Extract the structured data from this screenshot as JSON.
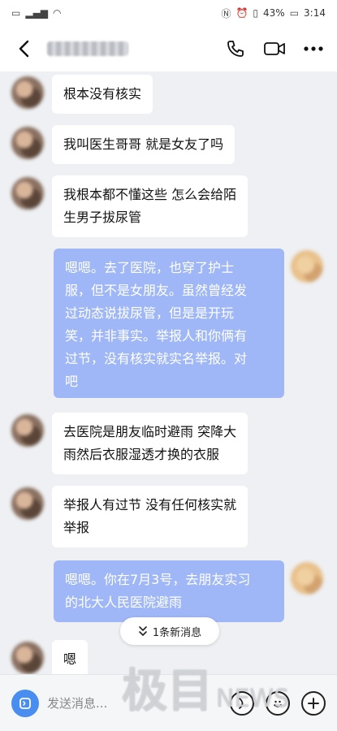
{
  "status_bar": {
    "battery": "43%",
    "time": "3:14"
  },
  "header": {
    "back_icon": "chevron-left-icon",
    "call_icon": "phone-icon",
    "video_icon": "video-camera-icon",
    "more_icon": "more-horizontal-icon"
  },
  "messages": [
    {
      "sender": "them",
      "lines": [
        "根本没有核实"
      ]
    },
    {
      "sender": "them",
      "lines": [
        "我叫医生哥哥 就是女友了吗"
      ]
    },
    {
      "sender": "them",
      "lines": [
        "我根本都不懂这些 怎么会给陌",
        "生男子拔尿管"
      ]
    },
    {
      "sender": "me",
      "lines": [
        "嗯嗯。去了医院，也穿了护士",
        "服，但不是女朋友。虽然曾经发",
        "过动态说拔尿管，但是是开玩",
        "笑，并非事实。举报人和你俩有",
        "过节，没有核实就实名举报。对",
        "吧"
      ]
    },
    {
      "sender": "them",
      "lines": [
        "去医院是朋友临时避雨 突降大",
        "雨然后衣服湿透才换的衣服"
      ]
    },
    {
      "sender": "them",
      "lines": [
        "举报人有过节 没有任何核实就",
        "举报"
      ]
    },
    {
      "sender": "me",
      "lines": [
        "嗯嗯。你在7月3号，去朋友实习",
        "的北大人民医院避雨"
      ]
    },
    {
      "sender": "them",
      "lines": [
        "嗯"
      ]
    }
  ],
  "new_messages": {
    "label": "1条新消息",
    "icon": "double-chevron-down-icon"
  },
  "input": {
    "placeholder": "发送消息...",
    "voice_icon": "voice-icon",
    "emoji_icon": "emoji-icon",
    "plus_icon": "plus-icon"
  },
  "watermark": {
    "cn": "极目",
    "en": "NEWS"
  },
  "colors": {
    "outgoing_bubble": "#9fb7f6",
    "incoming_bubble": "#ffffff",
    "accent": "#4a8df0"
  }
}
